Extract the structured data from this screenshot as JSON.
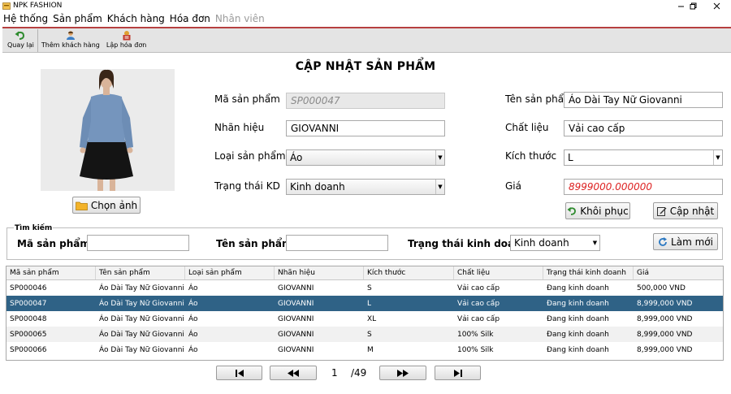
{
  "window": {
    "title": "NPK FASHION"
  },
  "menu": [
    "Hệ thống",
    "Sản phẩm",
    "Khách hàng",
    "Hóa đơn",
    "Nhân viên"
  ],
  "toolbar": {
    "back": "Quay lại",
    "add_customer": "Thêm khách hàng",
    "create_invoice": "Lập hóa đơn"
  },
  "form": {
    "title": "CẬP NHẬT SẢN PHẨM",
    "choose_image": "Chọn ảnh",
    "product_code_label": "Mã sản phẩm",
    "product_code": "SP000047",
    "brand_label": "Nhãn hiệu",
    "brand": "GIOVANNI",
    "category_label": "Loại sản phẩm",
    "category": "Áo",
    "status_label": "Trạng thái KD",
    "status": "Kinh doanh",
    "name_label": "Tên sản phẩm",
    "name": "Áo Dài Tay Nữ Giovanni",
    "material_label": "Chất liệu",
    "material": "Vải cao cấp",
    "size_label": "Kích thước",
    "size": "L",
    "price_label": "Giá",
    "price": "8999000.000000",
    "restore": "Khôi phục",
    "update": "Cập nhật"
  },
  "search": {
    "legend": "Tìm kiếm",
    "code_label": "Mã sản phẩm:",
    "code": "",
    "name_label": "Tên sản phẩm:",
    "name": "",
    "status_label": "Trạng thái kinh doanh",
    "status": "Kinh doanh",
    "refresh": "Làm mới"
  },
  "table": {
    "headers": [
      "Mã sản phẩm",
      "Tên sản phẩm",
      "Loại sản phẩm",
      "Nhãn hiệu",
      "Kích thước",
      "Chất liệu",
      "Trạng thái kinh doanh",
      "Giá"
    ],
    "rows": [
      [
        "SP000046",
        "Áo Dài Tay Nữ Giovanni",
        "Áo",
        "GIOVANNI",
        "S",
        "Vải cao cấp",
        "Đang kinh doanh",
        "500,000 VND"
      ],
      [
        "SP000047",
        "Áo Dài Tay Nữ Giovanni",
        "Áo",
        "GIOVANNI",
        "L",
        "Vải cao cấp",
        "Đang kinh doanh",
        "8,999,000 VND"
      ],
      [
        "SP000048",
        "Áo Dài Tay Nữ Giovanni",
        "Áo",
        "GIOVANNI",
        "XL",
        "Vải cao cấp",
        "Đang kinh doanh",
        "8,999,000 VND"
      ],
      [
        "SP000065",
        "Áo Dài Tay Nữ Giovanni D...",
        "Áo",
        "GIOVANNI",
        "S",
        "100% Silk",
        "Đang kinh doanh",
        "8,999,000 VND"
      ],
      [
        "SP000066",
        "Áo Dài Tay Nữ Giovanni D...",
        "Áo",
        "GIOVANNI",
        "M",
        "100% Silk",
        "Đang kinh doanh",
        "8,999,000 VND"
      ]
    ],
    "selected_row": 1
  },
  "pager": {
    "page": "1",
    "total": "/49"
  },
  "colors": {
    "selected_row": "#2f6286",
    "toolbar_border": "#b64040",
    "price_text": "#dd2222"
  }
}
